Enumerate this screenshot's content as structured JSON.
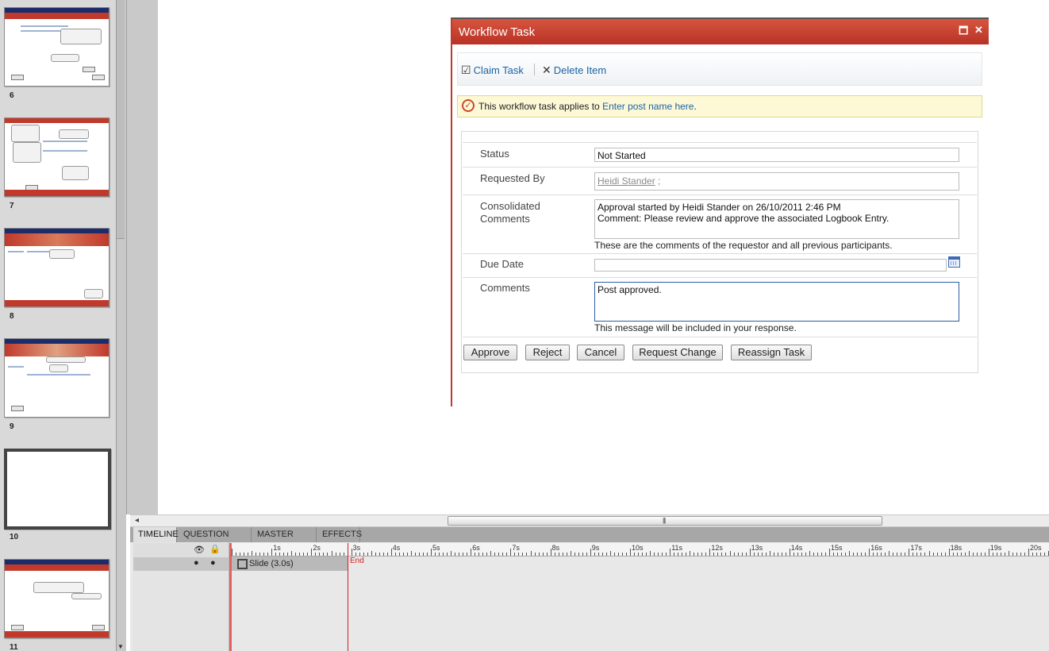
{
  "filmstrip": {
    "slides": [
      {
        "number": "6"
      },
      {
        "number": "7"
      },
      {
        "number": "8"
      },
      {
        "number": "9"
      },
      {
        "number": "10"
      },
      {
        "number": "11"
      }
    ]
  },
  "dialog": {
    "title": "Workflow Task",
    "toolbar": {
      "claim_task": "Claim Task",
      "delete_item": "Delete Item"
    },
    "info": {
      "prefix": "This workflow task applies to ",
      "link": "Enter post name here",
      "suffix": "."
    },
    "fields": {
      "status": {
        "label": "Status",
        "value": "Not Started"
      },
      "requested_by": {
        "label": "Requested By",
        "user": "Heidi Stander",
        "suffix": " ;"
      },
      "consolidated_comments": {
        "label": "Consolidated Comments",
        "line1": "Approval started by Heidi Stander on 26/10/2011 2:46 PM",
        "line2": "Comment: Please review and approve the associated Logbook Entry.",
        "help": "These are the comments of the requestor and all previous participants."
      },
      "due_date": {
        "label": "Due Date",
        "value": ""
      },
      "comments": {
        "label": "Comments",
        "value": "Post approved.",
        "help": "This message will be included in your response."
      }
    },
    "buttons": {
      "approve": "Approve",
      "reject": "Reject",
      "cancel": "Cancel",
      "request_change": "Request Change",
      "reassign_task": "Reassign Task"
    }
  },
  "timeline": {
    "tabs": [
      "TIMELINE",
      "QUESTION POOL",
      "MASTER SLIDE",
      "EFFECTS"
    ],
    "ruler_labels": [
      "1s",
      "2s",
      "3s",
      "4s",
      "5s",
      "6s",
      "7s",
      "8s",
      "9s",
      "10s",
      "11s",
      "12s",
      "13s",
      "14s",
      "15s",
      "16s",
      "17s",
      "18s",
      "19s",
      "20s"
    ],
    "slide_item": "Slide (3.0s)",
    "end_label": "End"
  },
  "colors": {
    "dialog_title_bg": "#c0392b",
    "link": "#1a63a8",
    "end_marker": "#d62020"
  }
}
